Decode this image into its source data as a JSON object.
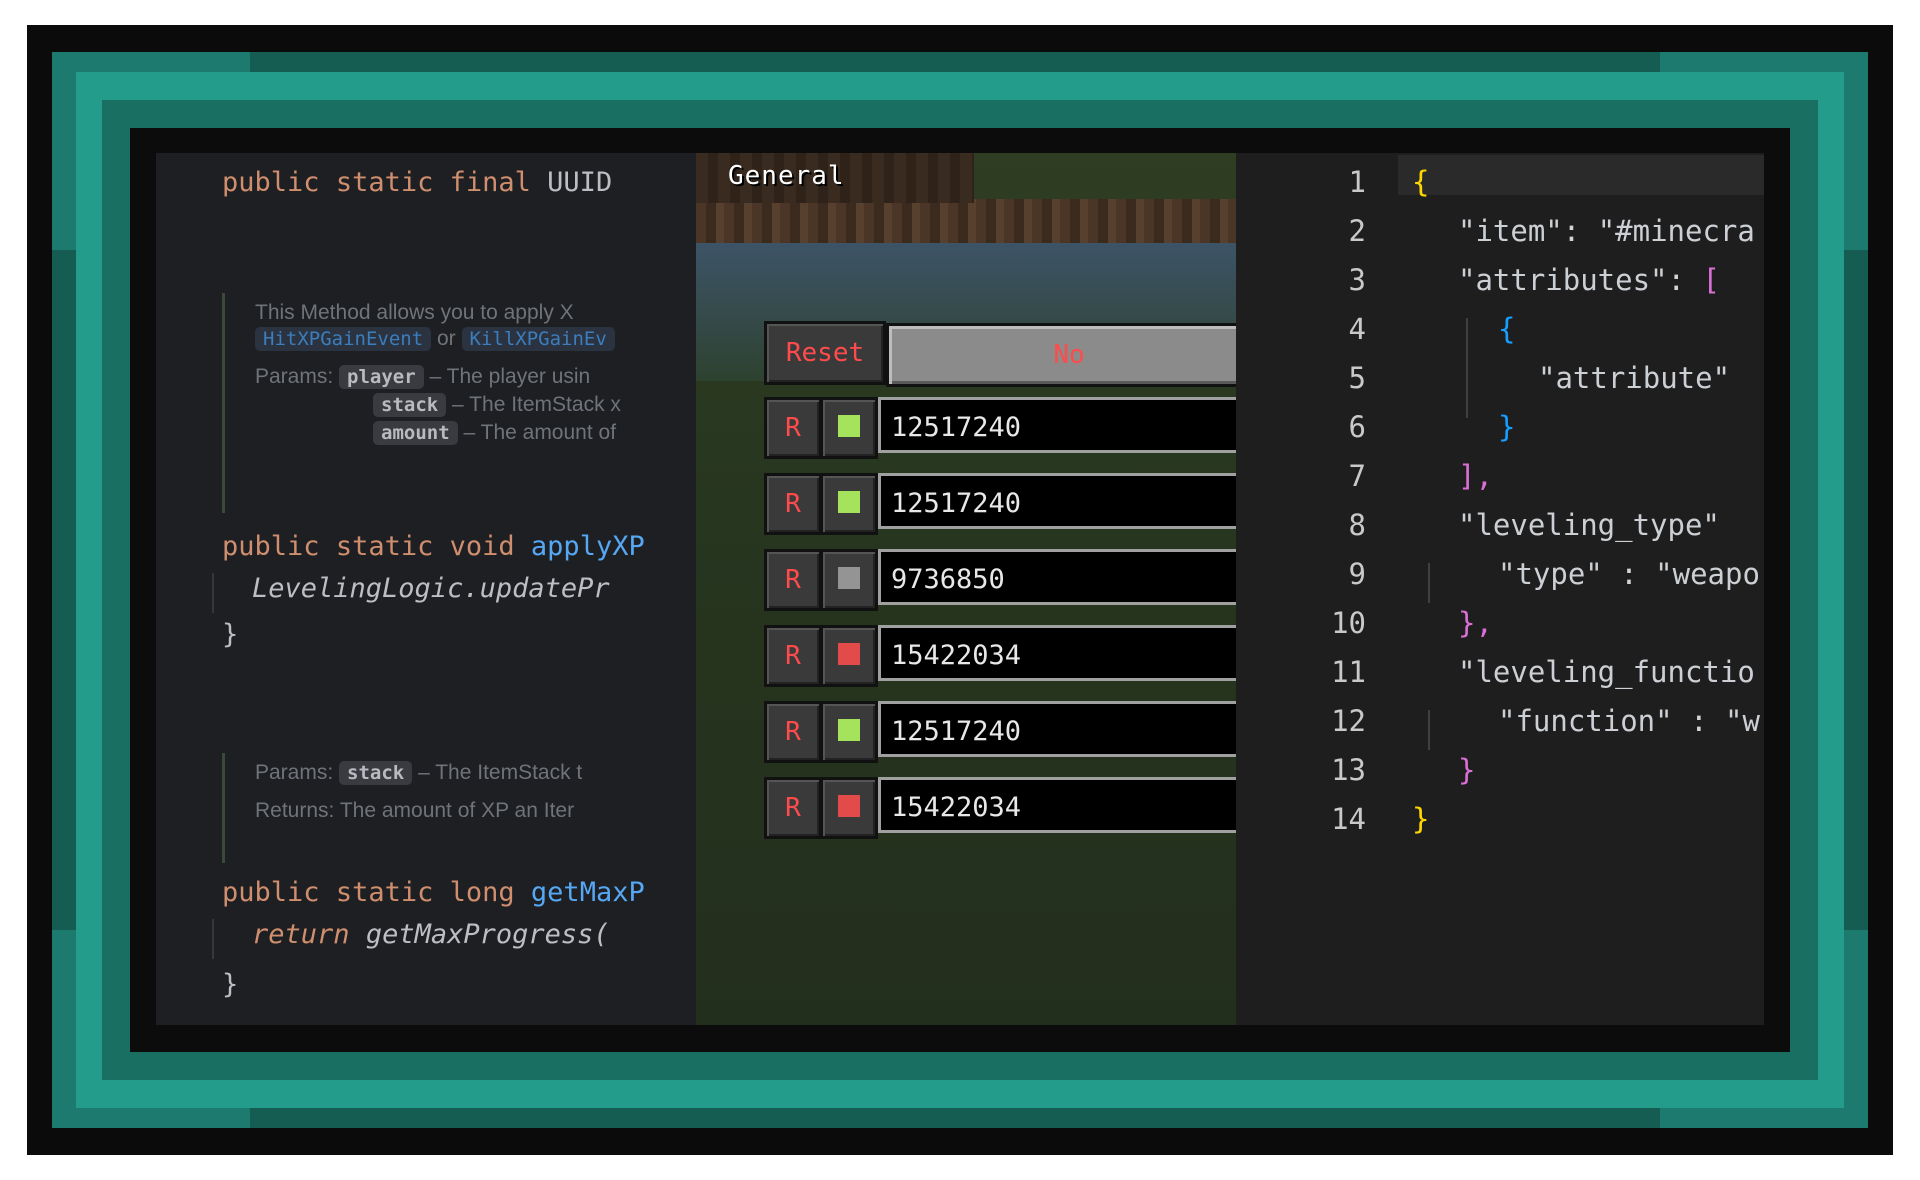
{
  "java": {
    "line_uuid": [
      "public",
      "static",
      "final",
      "UUID"
    ],
    "doc1_text": "This Method allows you to apply X",
    "doc1_link1": "HitXPGainEvent",
    "doc1_or": "or",
    "doc1_link2": "KillXPGainEv",
    "params_label": "Params:",
    "param1": "player",
    "param1_desc": "– The player usin",
    "param2": "stack",
    "param2_desc": "– The ItemStack x",
    "param3": "amount",
    "param3_desc": "– The amount of",
    "apply_sig": [
      "public",
      "static",
      "void",
      "applyXP"
    ],
    "apply_body": "LevelingLogic.updatePr",
    "close1": "}",
    "doc2_params_label": "Params:",
    "doc2_param": "stack",
    "doc2_param_desc": "– The ItemStack t",
    "doc2_returns": "Returns: The amount of XP an Iter",
    "getmax_sig": [
      "public",
      "static",
      "long",
      "getMaxP"
    ],
    "getmax_body": [
      "return",
      "getMaxProgress("
    ],
    "close2": "}"
  },
  "game": {
    "tab_label": "General",
    "reset_label": "Reset",
    "toggle_label": "No",
    "rows": [
      {
        "r_label": "R",
        "swatch": "#a5e35d",
        "value": "12517240"
      },
      {
        "r_label": "R",
        "swatch": "#a5e35d",
        "value": "12517240"
      },
      {
        "r_label": "R",
        "swatch": "#949494",
        "value": "9736850"
      },
      {
        "r_label": "R",
        "swatch": "#e34b4b",
        "value": "15422034"
      },
      {
        "r_label": "R",
        "swatch": "#a5e35d",
        "value": "12517240"
      },
      {
        "r_label": "R",
        "swatch": "#e34b4b",
        "value": "15422034"
      }
    ]
  },
  "json_editor": {
    "line_numbers": [
      "1",
      "2",
      "3",
      "4",
      "5",
      "6",
      "7",
      "8",
      "9",
      "10",
      "11",
      "12",
      "13",
      "14"
    ],
    "l1": "{",
    "l2_key": "\"item\"",
    "l2_val": "\"#minecra",
    "l3_key": "\"attributes\"",
    "l3_br": "[",
    "l4": "{",
    "l5_key": "\"attribute\"",
    "l6": "}",
    "l7": "],",
    "l8_key": "\"leveling_type\"",
    "l9_key": "\"type\"",
    "l9_val": "\"weapo",
    "l10": "},",
    "l11_key": "\"leveling_functio",
    "l12_key": "\"function\"",
    "l12_val": "\"w",
    "l13": "}",
    "l14": "}"
  },
  "colors": {
    "frame_teal": "#1c7b6e",
    "frame_highlight": "#249c8b",
    "reset_text": "#ff4b4b"
  }
}
